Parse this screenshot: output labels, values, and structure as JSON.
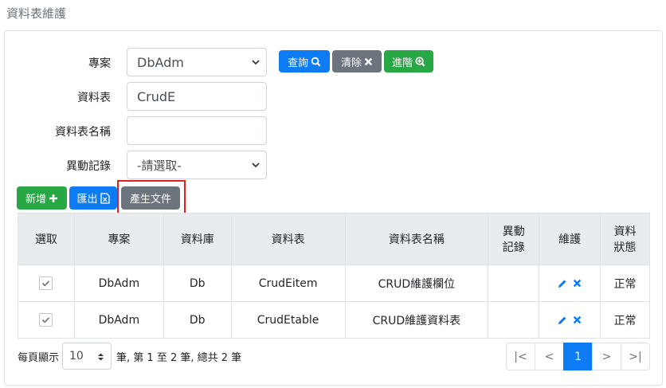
{
  "page_title": "資料表維護",
  "form": {
    "project_label": "專案",
    "project_value": "DbAdm",
    "table_label": "資料表",
    "table_value": "CrudE",
    "table_name_label": "資料表名稱",
    "table_name_value": "",
    "change_label": "異動記錄",
    "change_value": "-請選取-"
  },
  "toolbar": {
    "query": "查詢",
    "clear": "清除",
    "advanced": "進階",
    "add": "新增",
    "export": "匯出",
    "generate_doc": "產生文件"
  },
  "table": {
    "headers": [
      "選取",
      "專案",
      "資料庫",
      "資料表",
      "資料表名稱",
      "異動\n記錄",
      "維護",
      "資料\n狀態"
    ],
    "header_change_1": "異動",
    "header_change_2": "記錄",
    "header_status_1": "資料",
    "header_status_2": "狀態",
    "rows": [
      {
        "project": "DbAdm",
        "db": "Db",
        "table": "CrudEitem",
        "name": "CRUD維護欄位",
        "change": "",
        "status": "正常"
      },
      {
        "project": "DbAdm",
        "db": "Db",
        "table": "CrudEtable",
        "name": "CRUD維護資料表",
        "change": "",
        "status": "正常"
      }
    ]
  },
  "pager": {
    "per_page_label": "每頁顯示",
    "page_size": "10",
    "summary": "筆, 第 1 至 2 筆, 總共 2 筆",
    "first": "|<",
    "prev": "<",
    "current": "1",
    "next": ">",
    "last": ">|"
  },
  "colors": {
    "primary": "#0d7bf4",
    "secondary": "#6c757d",
    "success": "#28a745",
    "highlight": "#e02020"
  }
}
